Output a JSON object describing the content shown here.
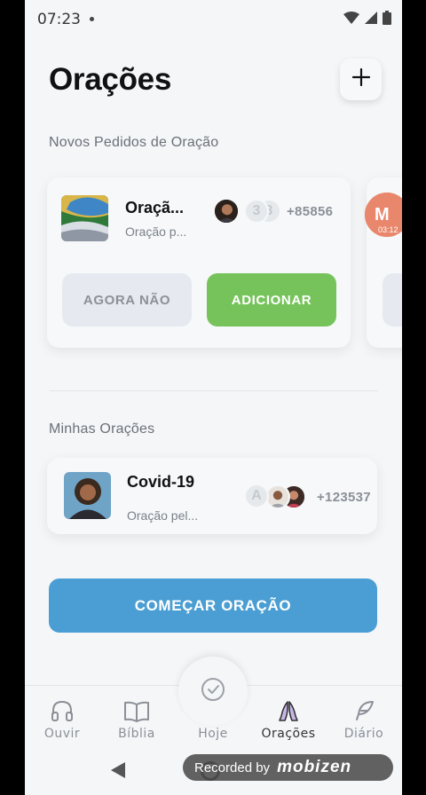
{
  "status_bar": {
    "time": "07:23"
  },
  "header": {
    "title": "Orações"
  },
  "requests": {
    "label": "Novos Pedidos de Oração",
    "card": {
      "title": "Oraçã...",
      "subtitle": "Oração p...",
      "avatar_letters": [
        "3",
        "3"
      ],
      "count": "+85856",
      "decline_label": "AGORA NÃO",
      "accept_label": "ADICIONAR"
    },
    "peek_card": {
      "time": "03:12"
    }
  },
  "my_prayers": {
    "label": "Minhas Orações",
    "card": {
      "title": "Covid-19",
      "subtitle": "Oração pel...",
      "avatar_letter": "A",
      "count": "+123537"
    }
  },
  "start_button": "COMEÇAR ORAÇÃO",
  "bottom_nav": {
    "items": [
      {
        "label": "Ouvir",
        "icon": "headphones-icon"
      },
      {
        "label": "Bíblia",
        "icon": "book-icon"
      },
      {
        "label": "Hoje",
        "icon": "check-circle-icon"
      },
      {
        "label": "Orações",
        "icon": "praying-hands-icon"
      },
      {
        "label": "Diário",
        "icon": "feather-icon"
      }
    ],
    "active": "Orações"
  },
  "recorder": {
    "text": "Recorded by",
    "brand": "mobizen"
  },
  "colors": {
    "accent_green": "#77c35b",
    "accent_blue": "#4a9ed3",
    "active_nav_icon": "#c9b7e8"
  }
}
